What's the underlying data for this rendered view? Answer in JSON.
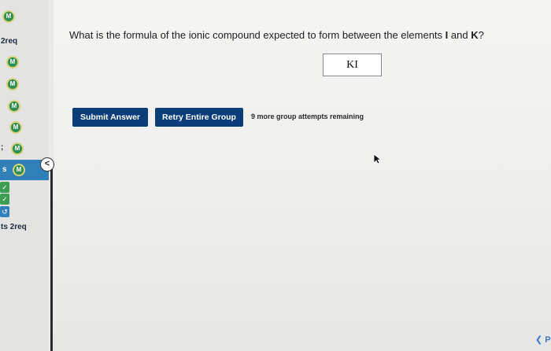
{
  "sidebar": {
    "items": [
      {
        "label": "",
        "badge": "M"
      },
      {
        "label": "2req",
        "badge": ""
      },
      {
        "label": "",
        "badge": "M"
      },
      {
        "label": "",
        "badge": "M"
      },
      {
        "label": "",
        "badge": "M"
      },
      {
        "label": "",
        "badge": "M"
      },
      {
        "label": ";",
        "badge": "M"
      },
      {
        "label": "s",
        "badge": "M"
      },
      {
        "label": "ts  2req",
        "badge": ""
      }
    ],
    "collapse_label": "<"
  },
  "question": {
    "prefix": "What is the formula of the ionic compound expected to form between the elements ",
    "element1": "I",
    "middle": " and ",
    "element2": "K",
    "suffix": "?"
  },
  "answer": {
    "value": "KI"
  },
  "actions": {
    "submit_label": "Submit Answer",
    "retry_label": "Retry Entire Group",
    "attempts_text": "9 more group attempts remaining"
  },
  "corner_label": "❮ P",
  "colors": {
    "button_bg": "#0a3d7a",
    "active_sidebar": "#2f7fb8",
    "badge": "#2d8e52"
  }
}
